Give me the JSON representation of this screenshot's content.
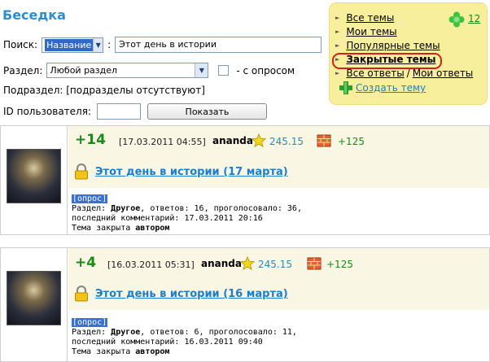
{
  "page_title": "Беседка",
  "filters": {
    "search_label": "Поиск:",
    "search_field_selected": "Название",
    "search_colon": ":",
    "search_value": "Этот день в истории",
    "section_label": "Раздел:",
    "section_selected": "Любой раздел",
    "poll_label": "- с опросом",
    "subsection_label": "Подраздел: [подразделы отсутствуют]",
    "user_id_label": "ID пользователя:",
    "user_id_value": "",
    "show_button": "Показать"
  },
  "menu": {
    "items": [
      {
        "label": "Все темы"
      },
      {
        "label": "Мои темы"
      },
      {
        "label": "Популярные темы"
      },
      {
        "label": "Закрытые темы",
        "active": true
      },
      {
        "label_a": "Все ответы",
        "separator": "/",
        "label_b": "Мои ответы"
      },
      {
        "label": "Создать тему"
      }
    ],
    "online_count": "12"
  },
  "topics": [
    {
      "score": "+14",
      "date": "[17.03.2011 04:55]",
      "author": "ananda",
      "rating": "245.15",
      "karma": "+125",
      "title": "Этот день в истории (17 марта)",
      "badge": "[опрос]",
      "line1_prefix": "Раздел: ",
      "category": "Другое",
      "line1_suffix": ", ответов: 16, проголосовало: 36,",
      "line2": "последний комментарий: 17.03.2011 20:16",
      "line3_prefix": "Тема закрыта ",
      "closed_by": "автором"
    },
    {
      "score": "+4",
      "date": "[16.03.2011 05:31]",
      "author": "ananda",
      "rating": "245.15",
      "karma": "+125",
      "title": "Этот день в истории (16 марта)",
      "badge": "[опрос]",
      "line1_prefix": "Раздел: ",
      "category": "Другое",
      "line1_suffix": ", ответов: 6, проголосовало: 11,",
      "line2": "последний комментарий: 16.03.2011 09:40",
      "line3_prefix": "Тема закрыта ",
      "closed_by": "автором"
    }
  ],
  "colors": {
    "menu_bg": "#f8ef9d",
    "active_outline": "#d42020",
    "score": "#1a8a1a",
    "link": "#1a7fd0",
    "title": "#2b8fd0"
  }
}
